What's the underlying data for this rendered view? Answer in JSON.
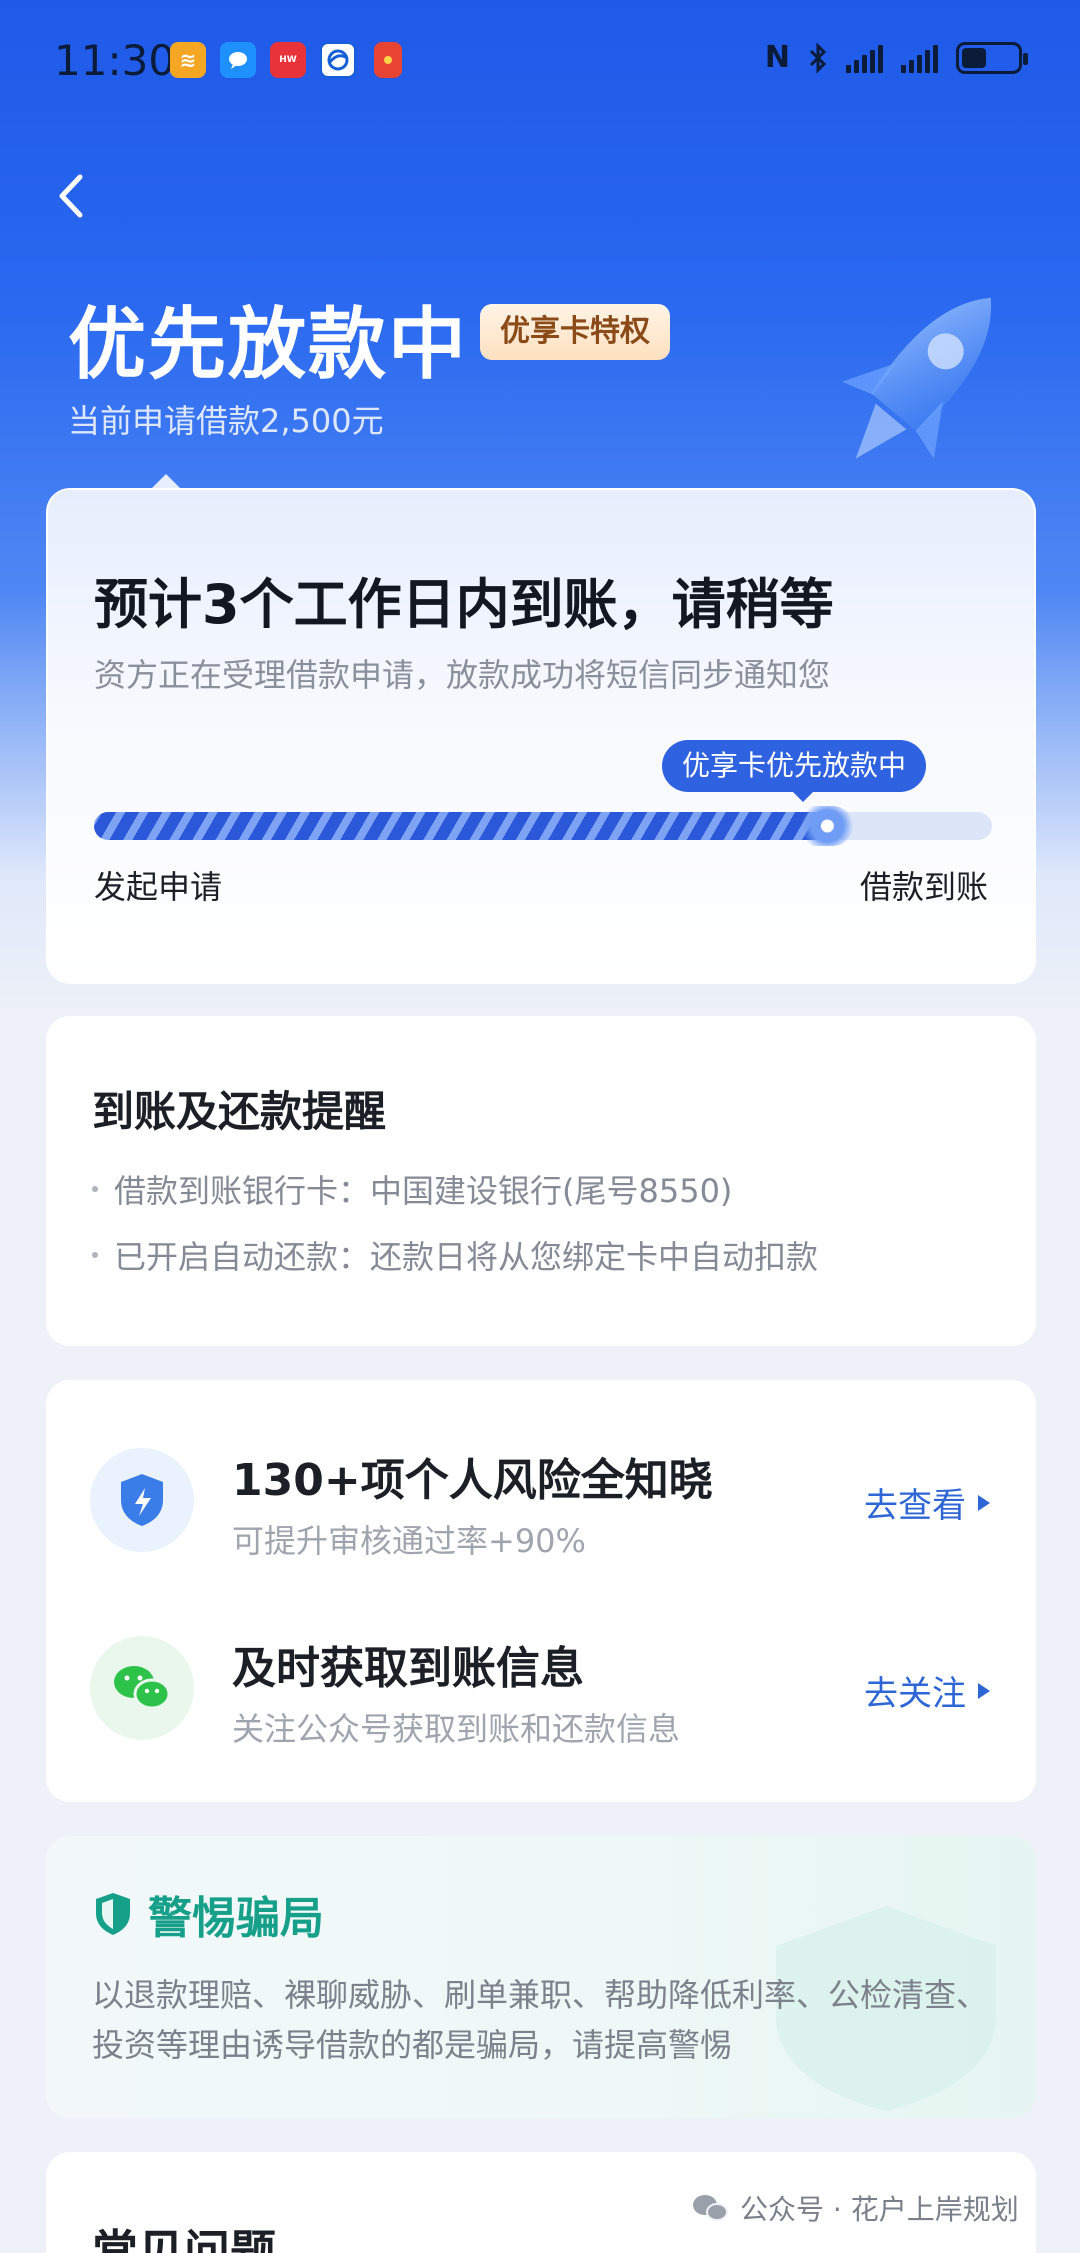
{
  "status_bar": {
    "time": "11:30",
    "notification_icons": [
      {
        "name": "app-orange-icon",
        "color": "#f5a623"
      },
      {
        "name": "message-icon",
        "color": "#1e90ff"
      },
      {
        "name": "huawei-icon",
        "color": "#e8333b"
      },
      {
        "name": "browser-icon",
        "color": "#1560d6"
      },
      {
        "name": "red-packet-icon",
        "color": "#e94334"
      }
    ],
    "battery_level": 0.45
  },
  "hero": {
    "title": "优先放款中",
    "badge": "优享卡特权",
    "subtitle": "当前申请借款2,500元"
  },
  "status_card": {
    "headline": "预计3个工作日内到账，请稍等",
    "description": "资方正在受理借款申请，放款成功将短信同步通知您",
    "progress_tooltip": "优享卡优先放款中",
    "progress_fraction": 0.83,
    "start_label": "发起申请",
    "end_label": "借款到账"
  },
  "reminder": {
    "title": "到账及还款提醒",
    "items": [
      "借款到账银行卡：中国建设银行(尾号8550)",
      "已开启自动还款：还款日将从您绑定卡中自动扣款"
    ]
  },
  "services": [
    {
      "title": "130+项个人风险全知晓",
      "subtitle": "可提升审核通过率+90%",
      "link": "去查看",
      "icon": "shield-lightning-icon"
    },
    {
      "title": "及时获取到账信息",
      "subtitle": "关注公众号获取到账和还款信息",
      "link": "去关注",
      "icon": "wechat-icon"
    }
  ],
  "warning": {
    "title": "警惕骗局",
    "body": "以退款理赔、裸聊威胁、刷单兼职、帮助降低利率、公检清查、投资等理由诱导借款的都是骗局，请提高警惕"
  },
  "faq": {
    "title": "常见问题"
  },
  "credit": {
    "text": "公众号 · 花户上岸规划"
  },
  "colors": {
    "brand_blue": "#2f62e0",
    "warning_green": "#16a08a",
    "link_blue": "#2f66d6"
  }
}
